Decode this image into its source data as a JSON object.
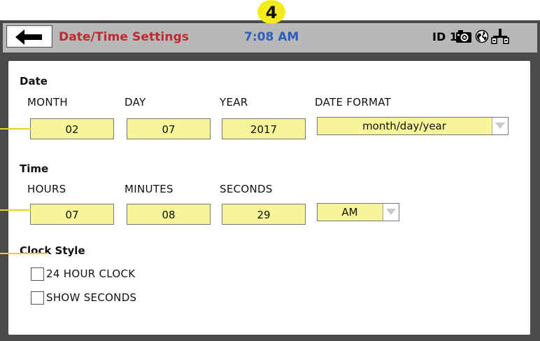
{
  "callout": {
    "number": "4"
  },
  "header": {
    "back_icon": "arrow-left-icon",
    "title": "Date/Time Settings",
    "clock": "7:08 AM",
    "device_id": "ID 1",
    "icons": [
      "camera-icon",
      "globe-icon",
      "network-icon"
    ]
  },
  "date": {
    "section_label": "Date",
    "month_label": "MONTH",
    "day_label": "DAY",
    "year_label": "YEAR",
    "format_label": "DATE FORMAT",
    "month": "02",
    "day": "07",
    "year": "2017",
    "format": "month/day/year"
  },
  "time": {
    "section_label": "Time",
    "hours_label": "HOURS",
    "minutes_label": "MINUTES",
    "seconds_label": "SECONDS",
    "hours": "07",
    "minutes": "08",
    "seconds": "29",
    "ampm": "AM"
  },
  "clock_style": {
    "section_label": "Clock Style",
    "option_24h": "24 HOUR CLOCK",
    "option_seconds": "SHOW SECONDS"
  },
  "colors": {
    "title": "#c0292f",
    "clock": "#2b5ec0",
    "field_bg": "#f7f59a",
    "badge": "#f4ec1a",
    "header_bg": "#b8b8b8",
    "frame": "#4a4a4a"
  }
}
